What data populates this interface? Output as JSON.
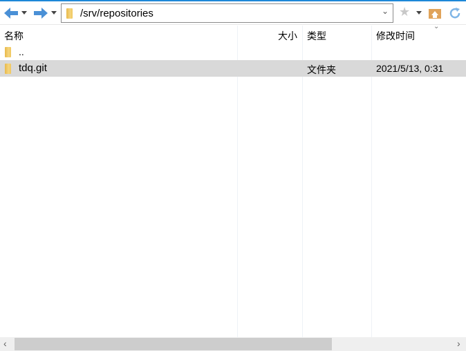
{
  "toolbar": {
    "path": "/srv/repositories"
  },
  "columns": {
    "name": "名称",
    "size": "大小",
    "type": "类型",
    "modified": "修改时间"
  },
  "rows": [
    {
      "name": "..",
      "size": "",
      "type": "",
      "modified": ""
    },
    {
      "name": "tdq.git",
      "size": "",
      "type": "文件夹",
      "modified": "2021/5/13, 0:31"
    }
  ],
  "colors": {
    "accent": "#1e88d8",
    "selected_row": "#d9d9d9"
  }
}
